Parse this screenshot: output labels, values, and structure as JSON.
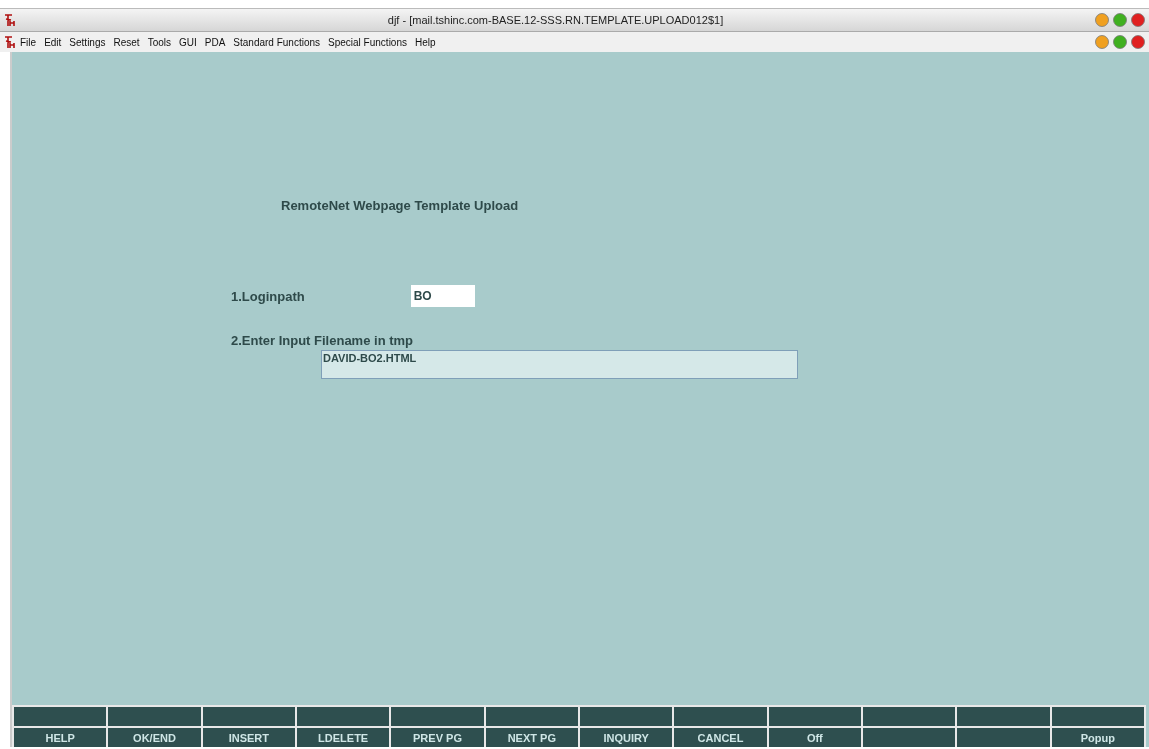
{
  "window": {
    "title": "djf - [mail.tshinc.com-BASE.12-SSS.RN.TEMPLATE.UPLOAD012$1]"
  },
  "menu": [
    "File",
    "Edit",
    "Settings",
    "Reset",
    "Tools",
    "GUI",
    "PDA",
    "Standard Functions",
    "Special Functions",
    "Help"
  ],
  "form": {
    "title": "RemoteNet Webpage Template Upload",
    "fields": [
      {
        "label": "1.Loginpath",
        "value": "BO",
        "kind": "short"
      },
      {
        "label": "2.Enter Input Filename in tmp",
        "value": "DAVID-BO2.HTML",
        "kind": "long"
      }
    ]
  },
  "function_keys": [
    {
      "kind": "labeled",
      "label": "HELP"
    },
    {
      "kind": "labeled",
      "label": "OK/END"
    },
    {
      "kind": "labeled",
      "label": "INSERT"
    },
    {
      "kind": "labeled",
      "label": "LDELETE"
    },
    {
      "kind": "labeled",
      "label": "PREV PG"
    },
    {
      "kind": "labeled",
      "label": "NEXT PG"
    },
    {
      "kind": "labeled",
      "label": "INQUIRY"
    },
    {
      "kind": "labeled",
      "label": "CANCEL"
    },
    {
      "kind": "labeled",
      "label": "Off"
    },
    {
      "kind": "blank"
    },
    {
      "kind": "blank"
    },
    {
      "kind": "labeled",
      "label": "Popup"
    }
  ]
}
